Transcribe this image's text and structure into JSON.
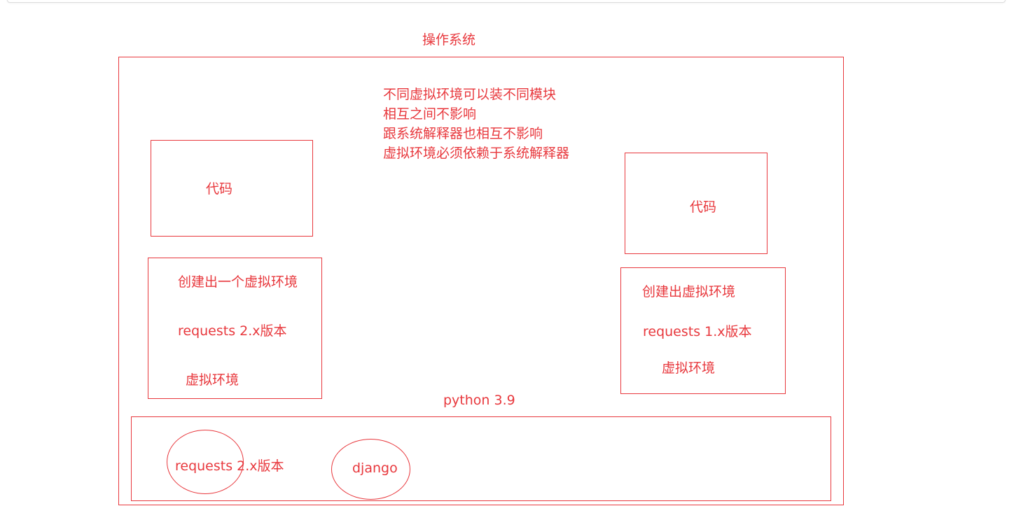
{
  "diagram": {
    "os_label": "操作系统",
    "notes": [
      "不同虚拟环境可以装不同模块",
      "相互之间不影响",
      "跟系统解释器也相互不影响",
      "虚拟环境必须依赖于系统解释器"
    ],
    "left_code_label": "代码",
    "left_venv": {
      "title": "创建出一个虚拟环境",
      "package": "requests 2.x版本",
      "label": "虚拟环境"
    },
    "right_code_label": "代码",
    "right_venv": {
      "title": "创建出虚拟环境",
      "package": "requests 1.x版本",
      "label": "虚拟环境"
    },
    "python_label": "python 3.9",
    "system_packages": [
      "requests 2.x版本",
      "django"
    ],
    "stroke_color": "#e8383d"
  }
}
